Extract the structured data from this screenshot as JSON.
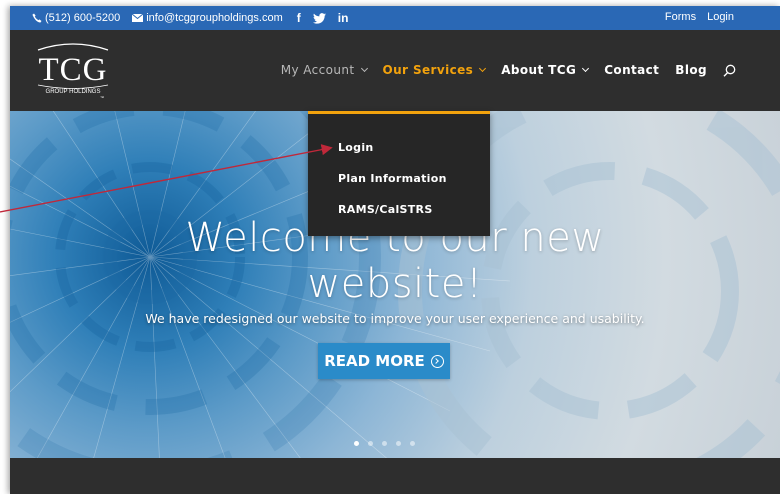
{
  "topbar": {
    "phone": "(512) 600-5200",
    "email": "info@tcggroupholdings.com",
    "social": [
      "f",
      "twitter",
      "in"
    ],
    "links": [
      "Forms",
      "Login"
    ],
    "bg_color": "#2a68b5"
  },
  "logo": {
    "text": "TCG",
    "subtext": "GROUP HOLDINGS",
    "tm": "™"
  },
  "nav": {
    "items": [
      {
        "label": "My Account",
        "dropdown": true,
        "state": "muted"
      },
      {
        "label": "Our Services",
        "dropdown": true,
        "state": "active"
      },
      {
        "label": "About TCG",
        "dropdown": true,
        "state": "normal"
      },
      {
        "label": "Contact",
        "dropdown": false,
        "state": "normal"
      },
      {
        "label": "Blog",
        "dropdown": false,
        "state": "normal"
      }
    ],
    "search_icon": "search-icon",
    "active_color": "#f2a20d"
  },
  "dropdown": {
    "items": [
      "Login",
      "Plan Information",
      "RAMS/CalSTRS"
    ]
  },
  "hero": {
    "title_line1": "Welcome to our new",
    "title_line2": "website!",
    "subtitle": "We have redesigned our website to improve your user experience and usability.",
    "button_label": "READ MORE",
    "slides": 5,
    "active_slide": 1,
    "button_color": "#2a8bc9"
  },
  "annotation": {
    "arrow_color": "#c0283a",
    "target": "Login"
  }
}
